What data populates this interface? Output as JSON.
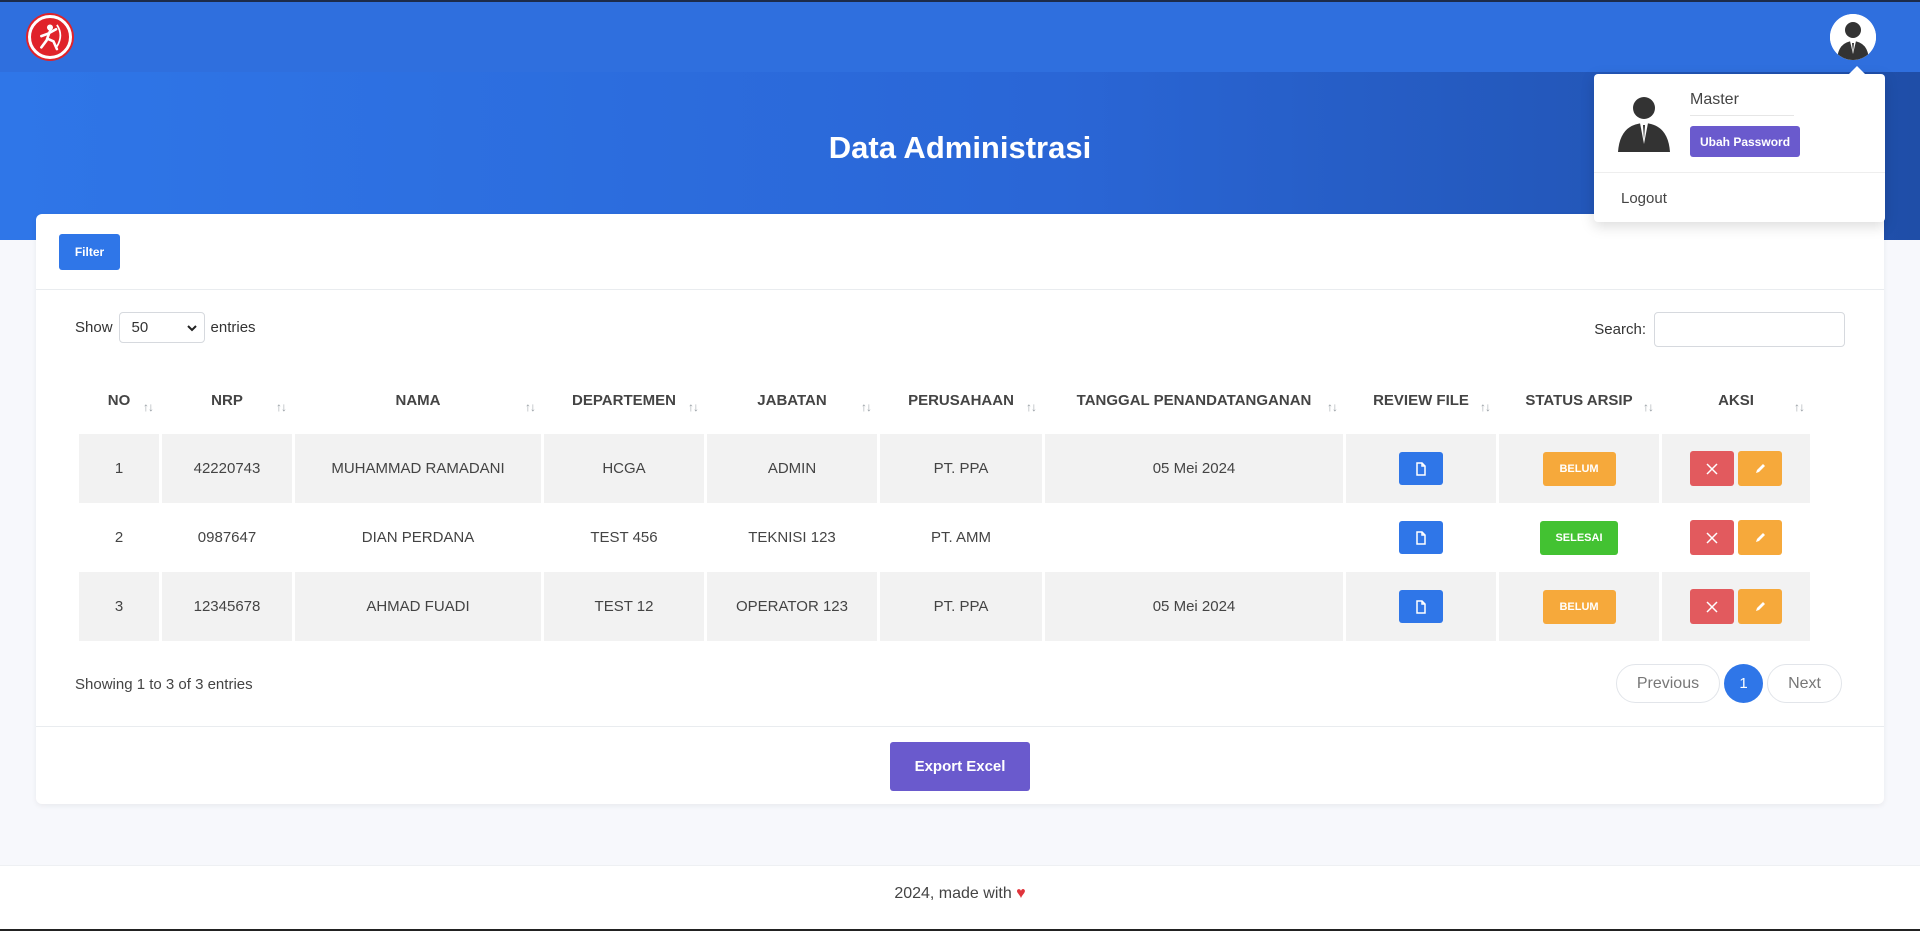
{
  "page": {
    "title": "Data Administrasi"
  },
  "toolbar": {
    "filter_label": "Filter"
  },
  "table_controls": {
    "show_label": "Show",
    "entries_value": "50",
    "entries_label": "entries",
    "search_label": "Search:",
    "search_value": ""
  },
  "table": {
    "headers": [
      "NO",
      "NRP",
      "NAMA",
      "DEPARTEMEN",
      "JABATAN",
      "PERUSAHAAN",
      "TANGGAL PENANDATANGANAN",
      "REVIEW FILE",
      "STATUS ARSIP",
      "AKSI"
    ],
    "rows": [
      {
        "no": "1",
        "nrp": "42220743",
        "nama": "MUHAMMAD RAMADANI",
        "departemen": "HCGA",
        "jabatan": "ADMIN",
        "perusahaan": "PT. PPA",
        "tanggal": "05 Mei 2024",
        "status": "BELUM"
      },
      {
        "no": "2",
        "nrp": "0987647",
        "nama": "DIAN PERDANA",
        "departemen": "TEST 456",
        "jabatan": "TEKNISI 123",
        "perusahaan": "PT. AMM",
        "tanggal": "",
        "status": "SELESAI"
      },
      {
        "no": "3",
        "nrp": "12345678",
        "nama": "AHMAD FUADI",
        "departemen": "TEST 12",
        "jabatan": "OPERATOR 123",
        "perusahaan": "PT. PPA",
        "tanggal": "05 Mei 2024",
        "status": "BELUM"
      }
    ]
  },
  "pagination": {
    "info": "Showing 1 to 3 of 3 entries",
    "previous_label": "Previous",
    "current_page": "1",
    "next_label": "Next"
  },
  "export": {
    "label": "Export Excel"
  },
  "footer": {
    "text": "2024, made with"
  },
  "user_menu": {
    "name": "Master",
    "change_password_label": "Ubah Password",
    "logout_label": "Logout"
  },
  "icons": {
    "logo": "archer-logo-icon",
    "avatar": "user-avatar-icon",
    "review": "file-icon",
    "delete": "close-icon",
    "edit": "pencil-icon",
    "sort": "sort-icon",
    "dropdown": "chevron-down-icon",
    "heart": "heart-icon"
  },
  "colors": {
    "primary": "#2f76e8",
    "purple": "#6a5acd",
    "belum": "#f6a93b",
    "selesai": "#43c232",
    "danger": "#e25a5e"
  }
}
